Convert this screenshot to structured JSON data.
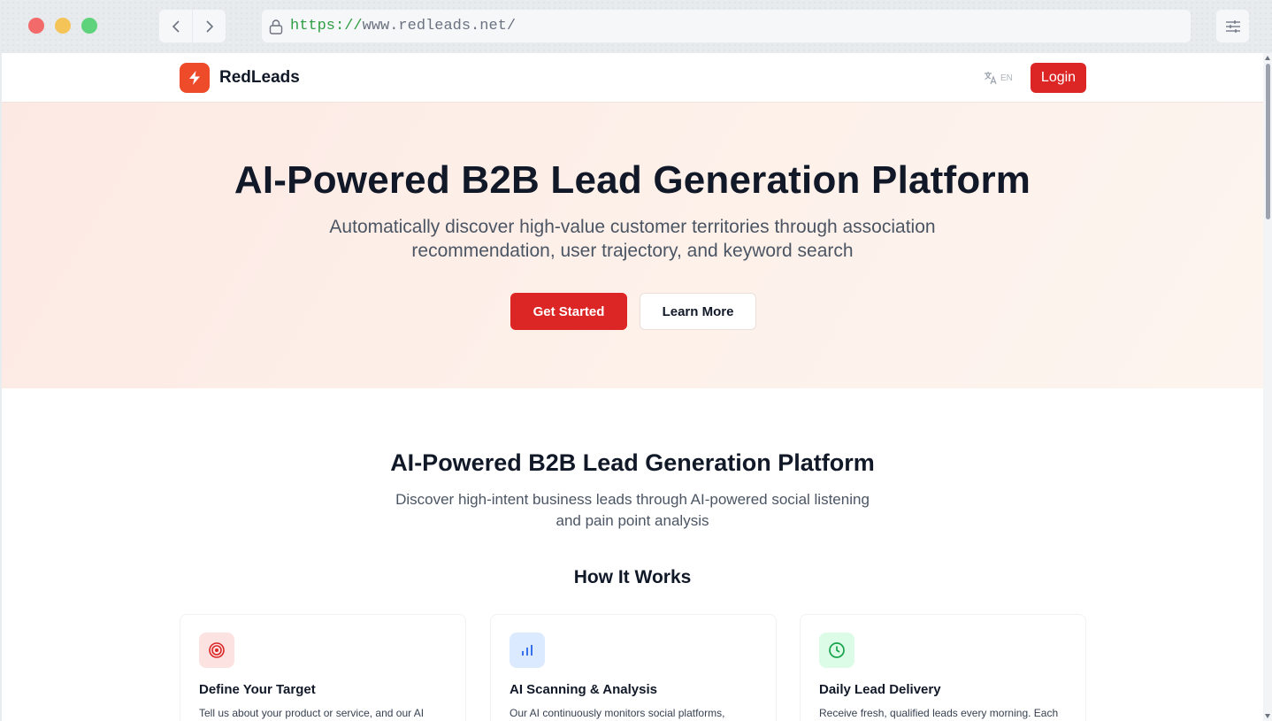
{
  "browser": {
    "url_scheme": "https://",
    "url_rest": "www.redleads.net/",
    "back_icon": "chevron-left-icon",
    "forward_icon": "chevron-right-icon"
  },
  "header": {
    "brand": "RedLeads",
    "lang_label": "EN",
    "login_label": "Login"
  },
  "hero": {
    "title": "AI-Powered B2B Lead Generation Platform",
    "subtitle": "Automatically discover high-value customer territories through association recommendation, user trajectory, and keyword search",
    "primary_cta": "Get Started",
    "secondary_cta": "Learn More"
  },
  "features": {
    "title": "AI-Powered B2B Lead Generation Platform",
    "subtitle": "Discover high-intent business leads through AI-powered social listening and pain point analysis",
    "how_title": "How It Works",
    "cards": [
      {
        "icon": "target-icon",
        "title": "Define Your Target",
        "desc": "Tell us about your product or service, and our AI"
      },
      {
        "icon": "bar-chart-icon",
        "title": "AI Scanning & Analysis",
        "desc": "Our AI continuously monitors social platforms,"
      },
      {
        "icon": "clock-icon",
        "title": "Daily Lead Delivery",
        "desc": "Receive fresh, qualified leads every morning. Each"
      }
    ]
  },
  "colors": {
    "brand_red": "#dc2626",
    "logo_orange": "#ee4b2b",
    "hero_bg": "#fdeee8"
  }
}
